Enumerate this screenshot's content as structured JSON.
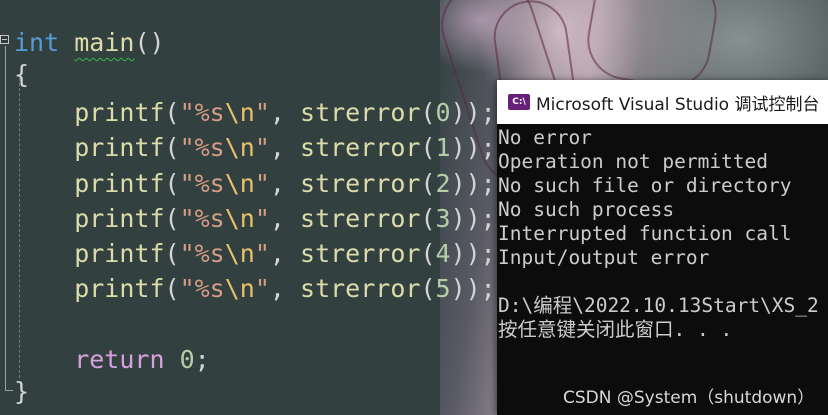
{
  "editor": {
    "lines": [
      {
        "tokens": [
          {
            "t": "int",
            "c": "kw"
          },
          {
            "t": " ",
            "c": "punc"
          },
          {
            "t": "main",
            "c": "fn squiggle"
          },
          {
            "t": "()",
            "c": "punc"
          }
        ]
      },
      {
        "tokens": [
          {
            "t": "{",
            "c": "punc"
          }
        ]
      },
      {
        "tokens": [
          {
            "t": "    printf",
            "c": "fn"
          },
          {
            "t": "(",
            "c": "punc"
          },
          {
            "t": "\"%s",
            "c": "str"
          },
          {
            "t": "\\n",
            "c": "esc"
          },
          {
            "t": "\"",
            "c": "str"
          },
          {
            "t": ", ",
            "c": "punc"
          },
          {
            "t": "strerror",
            "c": "fn"
          },
          {
            "t": "(",
            "c": "punc"
          },
          {
            "t": "0",
            "c": "num"
          },
          {
            "t": "));",
            "c": "punc"
          }
        ]
      },
      {
        "tokens": [
          {
            "t": "    printf",
            "c": "fn"
          },
          {
            "t": "(",
            "c": "punc"
          },
          {
            "t": "\"%s",
            "c": "str"
          },
          {
            "t": "\\n",
            "c": "esc"
          },
          {
            "t": "\"",
            "c": "str"
          },
          {
            "t": ", ",
            "c": "punc"
          },
          {
            "t": "strerror",
            "c": "fn"
          },
          {
            "t": "(",
            "c": "punc"
          },
          {
            "t": "1",
            "c": "num"
          },
          {
            "t": "));",
            "c": "punc"
          }
        ]
      },
      {
        "tokens": [
          {
            "t": "    printf",
            "c": "fn"
          },
          {
            "t": "(",
            "c": "punc"
          },
          {
            "t": "\"%s",
            "c": "str"
          },
          {
            "t": "\\n",
            "c": "esc"
          },
          {
            "t": "\"",
            "c": "str"
          },
          {
            "t": ", ",
            "c": "punc"
          },
          {
            "t": "strerror",
            "c": "fn"
          },
          {
            "t": "(",
            "c": "punc"
          },
          {
            "t": "2",
            "c": "num"
          },
          {
            "t": "));",
            "c": "punc"
          }
        ]
      },
      {
        "tokens": [
          {
            "t": "    printf",
            "c": "fn"
          },
          {
            "t": "(",
            "c": "punc"
          },
          {
            "t": "\"%s",
            "c": "str"
          },
          {
            "t": "\\n",
            "c": "esc"
          },
          {
            "t": "\"",
            "c": "str"
          },
          {
            "t": ", ",
            "c": "punc"
          },
          {
            "t": "strerror",
            "c": "fn"
          },
          {
            "t": "(",
            "c": "punc"
          },
          {
            "t": "3",
            "c": "num"
          },
          {
            "t": "));",
            "c": "punc"
          }
        ]
      },
      {
        "tokens": [
          {
            "t": "    printf",
            "c": "fn"
          },
          {
            "t": "(",
            "c": "punc"
          },
          {
            "t": "\"%s",
            "c": "str"
          },
          {
            "t": "\\n",
            "c": "esc"
          },
          {
            "t": "\"",
            "c": "str"
          },
          {
            "t": ", ",
            "c": "punc"
          },
          {
            "t": "strerror",
            "c": "fn"
          },
          {
            "t": "(",
            "c": "punc"
          },
          {
            "t": "4",
            "c": "num"
          },
          {
            "t": "));",
            "c": "punc"
          }
        ]
      },
      {
        "tokens": [
          {
            "t": "    printf",
            "c": "fn"
          },
          {
            "t": "(",
            "c": "punc"
          },
          {
            "t": "\"%s",
            "c": "str"
          },
          {
            "t": "\\n",
            "c": "esc"
          },
          {
            "t": "\"",
            "c": "str"
          },
          {
            "t": ", ",
            "c": "punc"
          },
          {
            "t": "strerror",
            "c": "fn"
          },
          {
            "t": "(",
            "c": "punc"
          },
          {
            "t": "5",
            "c": "num"
          },
          {
            "t": "));",
            "c": "punc"
          }
        ]
      },
      {
        "tokens": [
          {
            "t": "    return",
            "c": "ret"
          },
          {
            "t": " ",
            "c": "punc"
          },
          {
            "t": "0",
            "c": "num"
          },
          {
            "t": ";",
            "c": "punc"
          }
        ]
      },
      {
        "tokens": [
          {
            "t": "}",
            "c": "punc"
          }
        ]
      }
    ]
  },
  "console": {
    "title": "Microsoft Visual Studio 调试控制台",
    "icon_label": "C:\\",
    "output": [
      "No error",
      "Operation not permitted",
      "No such file or directory",
      "No such process",
      "Interrupted function call",
      "Input/output error",
      "",
      "D:\\编程\\2022.10.13Start\\XS_2",
      "按任意键关闭此窗口. . ."
    ]
  },
  "watermark": "CSDN @System（shutdown）"
}
